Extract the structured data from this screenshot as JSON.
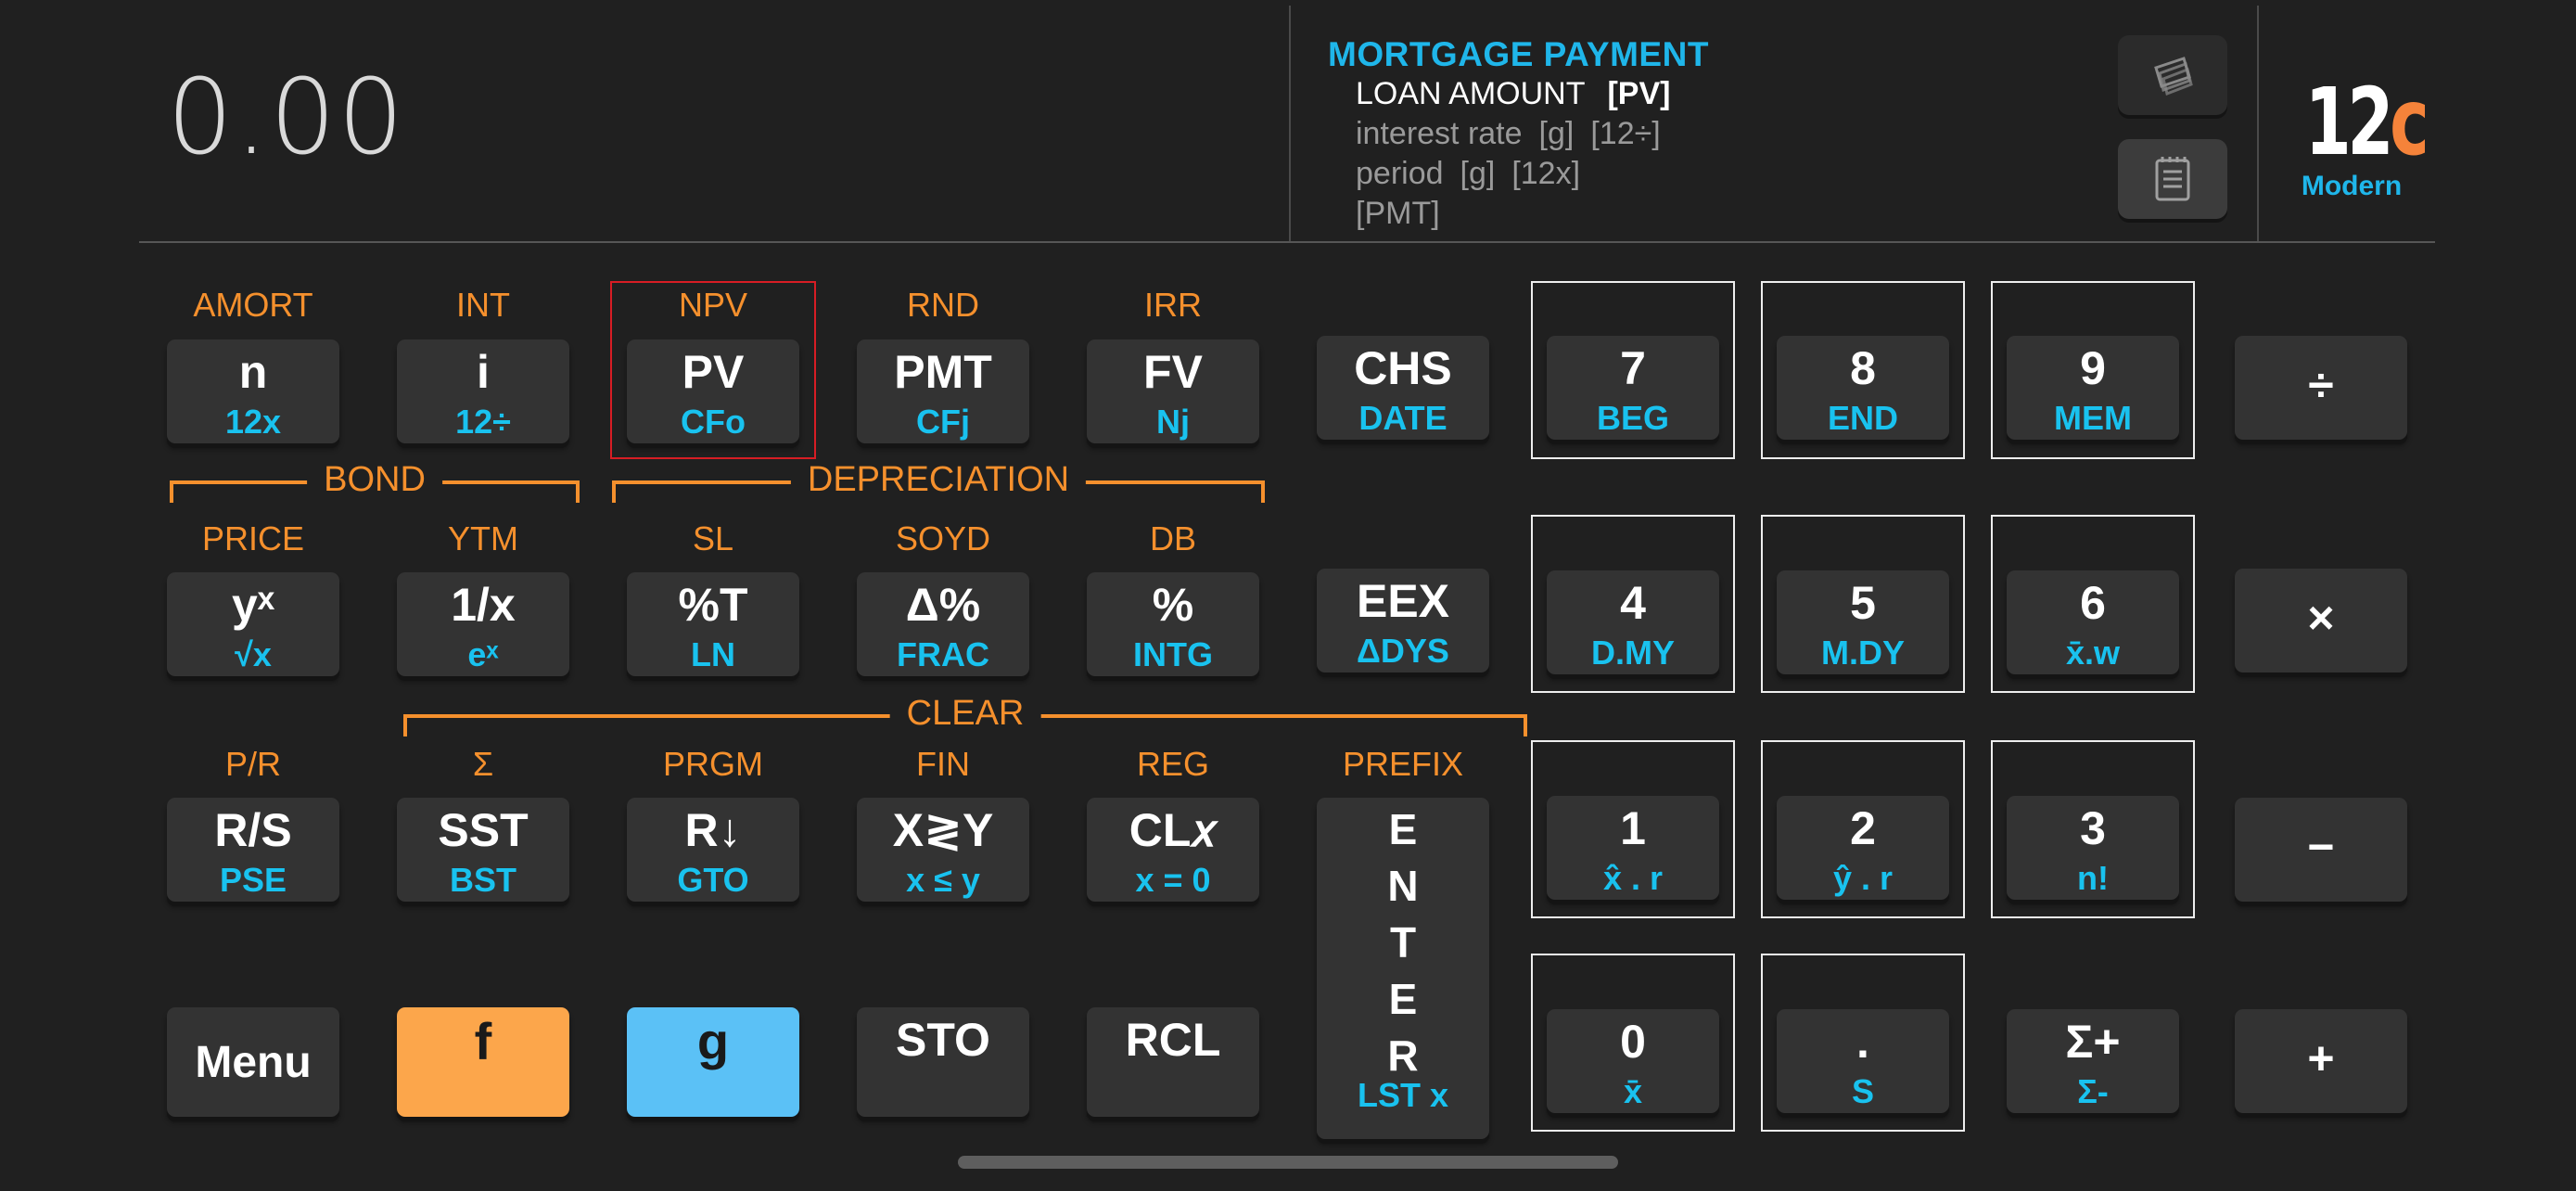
{
  "display": {
    "value": "0.00"
  },
  "help": {
    "title": "MORTGAGE PAYMENT",
    "line1_label": "LOAN AMOUNT",
    "line1_key": "[PV]",
    "line2_label": "interest rate",
    "line2_key1": "[g]",
    "line2_key2": "[12÷]",
    "line3_label": "period",
    "line3_key1": "[g]",
    "line3_key2": "[12x]",
    "line4": "[PMT]"
  },
  "icons": {
    "toggle_icon": "layers-icon",
    "notes_icon": "notepad-icon"
  },
  "logo": {
    "main": "12",
    "accent": "c",
    "sub": "Modern"
  },
  "colors": {
    "f_shift": "#fca64b",
    "g_shift": "#5bc1f6",
    "f_label": "#f5902d",
    "g_label": "#19c2ef",
    "highlight_frame": "#d71d24"
  },
  "brackets": {
    "bond": "BOND",
    "depreciation": "DEPRECIATION",
    "clear": "CLEAR"
  },
  "row1": {
    "f": [
      "AMORT",
      "INT",
      "NPV",
      "RND",
      "IRR"
    ],
    "keys": [
      {
        "main": "n",
        "sub": "12x"
      },
      {
        "main": "i",
        "sub": "12÷"
      },
      {
        "main": "PV",
        "sub": "CFo"
      },
      {
        "main": "PMT",
        "sub": "CFj"
      },
      {
        "main": "FV",
        "sub": "Nj"
      },
      {
        "main": "CHS",
        "sub": "DATE"
      },
      {
        "main": "7",
        "sub": "BEG"
      },
      {
        "main": "8",
        "sub": "END"
      },
      {
        "main": "9",
        "sub": "MEM"
      },
      {
        "main": "÷",
        "sub": ""
      }
    ]
  },
  "row2": {
    "f": [
      "PRICE",
      "YTM",
      "SL",
      "SOYD",
      "DB"
    ],
    "keys": [
      {
        "main": "yˣ",
        "sub": "√x"
      },
      {
        "main": "1/x",
        "sub": "eˣ"
      },
      {
        "main": "%T",
        "sub": "LN"
      },
      {
        "main": "Δ%",
        "sub": "FRAC"
      },
      {
        "main": "%",
        "sub": "INTG"
      },
      {
        "main": "EEX",
        "sub": "ΔDYS"
      },
      {
        "main": "4",
        "sub": "D.MY"
      },
      {
        "main": "5",
        "sub": "M.DY"
      },
      {
        "main": "6",
        "sub": "x̄.w"
      },
      {
        "main": "×",
        "sub": ""
      }
    ]
  },
  "row3": {
    "f": [
      "P/R",
      "Σ",
      "PRGM",
      "FIN",
      "REG",
      "PREFIX"
    ],
    "keys": [
      {
        "main": "R/S",
        "sub": "PSE"
      },
      {
        "main": "SST",
        "sub": "BST"
      },
      {
        "main": "R↓",
        "sub": "GTO"
      },
      {
        "main": "X≷Y",
        "sub": "x ≤ y"
      },
      {
        "main": "CL𝑥",
        "sub": "x = 0"
      },
      {
        "main": "ENTER",
        "sub": "LST x"
      },
      {
        "main": "1",
        "sub": "x̂ . r"
      },
      {
        "main": "2",
        "sub": "ŷ . r"
      },
      {
        "main": "3",
        "sub": "n!"
      },
      {
        "main": "−",
        "sub": ""
      }
    ]
  },
  "row4": {
    "keys": [
      {
        "main": "Menu",
        "sub": ""
      },
      {
        "main": "f",
        "sub": ""
      },
      {
        "main": "g",
        "sub": ""
      },
      {
        "main": "STO",
        "sub": ""
      },
      {
        "main": "RCL",
        "sub": ""
      },
      {
        "main": "0",
        "sub": "x̄"
      },
      {
        "main": ".",
        "sub": "S"
      },
      {
        "main": "Σ+",
        "sub": "Σ-"
      },
      {
        "main": "+",
        "sub": ""
      }
    ]
  }
}
